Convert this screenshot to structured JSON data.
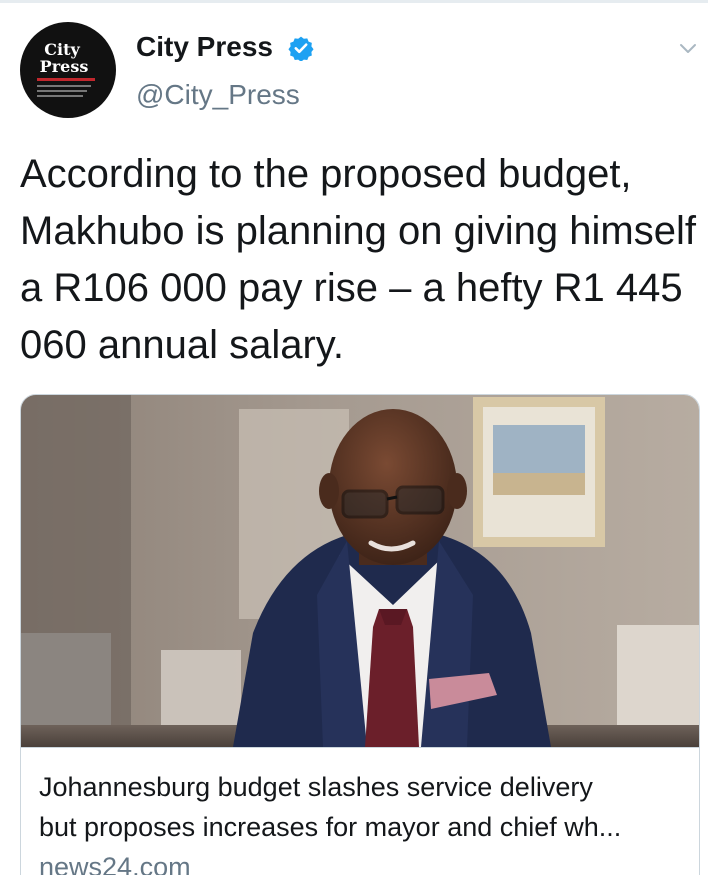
{
  "account": {
    "display_name": "City Press",
    "handle": "@City_Press",
    "verified": true,
    "avatar_logo_line1": "City",
    "avatar_logo_line2": "Press"
  },
  "tweet": {
    "text": "According to the proposed budget, Makhubo is planning on giving himself a R106 000 pay rise – a hefty R1 445 060 annual salary."
  },
  "link_card": {
    "title": "Johannesburg budget slashes service delivery\nbut proposes increases for mayor and chief wh...",
    "domain": "news24.com",
    "image_description_icon": "photo"
  },
  "icons": {
    "verified": "verified-badge-icon",
    "menu": "chevron-down-icon"
  },
  "colors": {
    "verified_blue": "#1da1f2",
    "text_primary": "#14171a",
    "text_secondary": "#657786",
    "border": "#ccd6dd"
  }
}
